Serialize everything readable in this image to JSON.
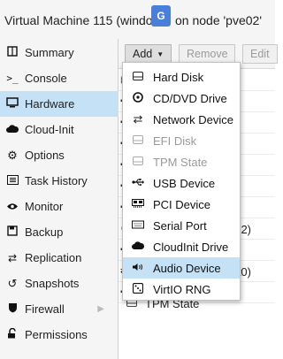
{
  "window": {
    "title_prefix": "Virtual Machine 115 (window",
    "translate_glyph": "G",
    "title_suffix": "on node 'pve02'"
  },
  "sidebar": {
    "items": [
      {
        "label": "Summary",
        "icon": "book-icon"
      },
      {
        "label": "Console",
        "icon": "terminal-icon"
      },
      {
        "label": "Hardware",
        "icon": "monitor-icon",
        "selected": true
      },
      {
        "label": "Cloud-Init",
        "icon": "cloud-icon"
      },
      {
        "label": "Options",
        "icon": "gear-icon"
      },
      {
        "label": "Task History",
        "icon": "list-icon"
      },
      {
        "label": "Monitor",
        "icon": "eye-icon"
      },
      {
        "label": "Backup",
        "icon": "floppy-icon"
      },
      {
        "label": "Replication",
        "icon": "retweet-icon"
      },
      {
        "label": "Snapshots",
        "icon": "history-icon"
      },
      {
        "label": "Firewall",
        "icon": "shield-icon",
        "has_submenu": true
      },
      {
        "label": "Permissions",
        "icon": "unlock-icon"
      }
    ]
  },
  "toolbar": {
    "add_label": "Add",
    "remove_label": "Remove",
    "edit_label": "Edit"
  },
  "grid": {
    "partial_texts": [
      "2)",
      "et0)"
    ],
    "bottom_row_label": "TPM State"
  },
  "add_menu": {
    "items": [
      {
        "label": "Hard Disk",
        "icon": "hdd-icon",
        "enabled": true
      },
      {
        "label": "CD/DVD Drive",
        "icon": "cdrom-icon",
        "enabled": true
      },
      {
        "label": "Network Device",
        "icon": "exchange-icon",
        "enabled": true
      },
      {
        "label": "EFI Disk",
        "icon": "hdd-icon",
        "enabled": false
      },
      {
        "label": "TPM State",
        "icon": "hdd-icon",
        "enabled": false
      },
      {
        "label": "USB Device",
        "icon": "usb-icon",
        "enabled": true
      },
      {
        "label": "PCI Device",
        "icon": "pci-card-icon",
        "enabled": true
      },
      {
        "label": "Serial Port",
        "icon": "serial-port-icon",
        "enabled": true
      },
      {
        "label": "CloudInit Drive",
        "icon": "cloud-icon",
        "enabled": true
      },
      {
        "label": "Audio Device",
        "icon": "volume-icon",
        "enabled": true,
        "highlighted": true
      },
      {
        "label": "VirtIO RNG",
        "icon": "dice-icon",
        "enabled": true
      }
    ]
  },
  "colors": {
    "selection": "#c5e1f5",
    "sidebar_bg": "#f5f5f5",
    "disabled_text": "#9a9a9a"
  }
}
